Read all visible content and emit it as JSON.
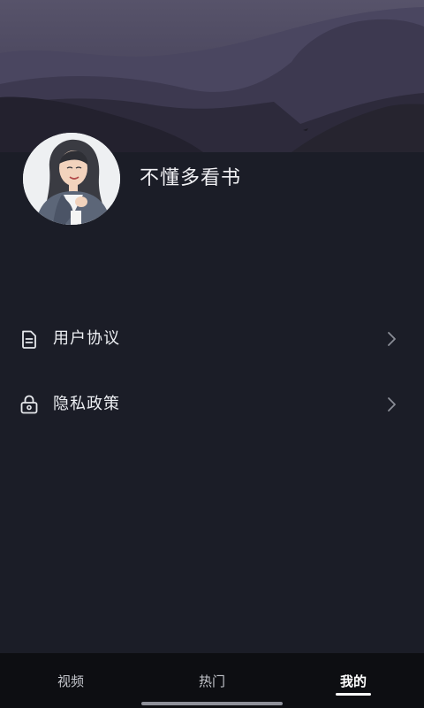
{
  "profile": {
    "username": "不懂多看书"
  },
  "menu": {
    "items": [
      {
        "label": "用户协议",
        "icon": "document-icon"
      },
      {
        "label": "隐私政策",
        "icon": "lock-icon"
      }
    ]
  },
  "tabbar": {
    "tabs": [
      {
        "label": "视频",
        "active": false
      },
      {
        "label": "热门",
        "active": false
      },
      {
        "label": "我的",
        "active": true
      }
    ]
  },
  "colors": {
    "background": "#1b1d27",
    "header_top": "#5a5570",
    "tabbar": "#0d0e12",
    "text": "#f1f1f4"
  }
}
